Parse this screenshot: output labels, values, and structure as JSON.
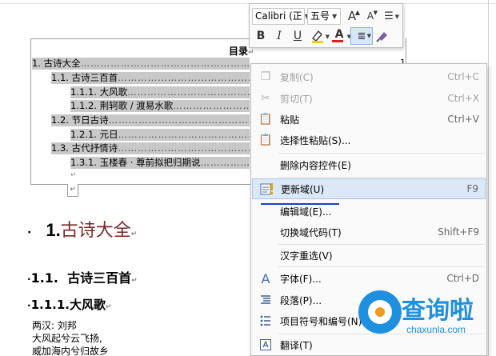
{
  "toolbar": {
    "font_name": "Calibri (正",
    "font_size": "五号",
    "grow_font": "A",
    "shrink_font": "A",
    "bold": "B",
    "italic": "I",
    "underline": "U",
    "font_color": "A"
  },
  "toc": {
    "title": "目录",
    "entries": [
      {
        "text": "1. 古诗大全",
        "page": "1"
      },
      {
        "text": "1.1. 古诗三百首"
      },
      {
        "text": "1.1.1. 大风歌"
      },
      {
        "text": "1.1.2. 荆轲歌 / 渡易水歌"
      },
      {
        "text": "1.2. 节日古诗"
      },
      {
        "text": "1.2.1. 元日"
      },
      {
        "text": "1.3. 古代抒情诗"
      },
      {
        "text": "1.3.1. 玉楼春 · 尊前拟把归期说"
      }
    ]
  },
  "body": {
    "h1_num": "1.",
    "h1_text": "古诗大全",
    "h2_num": "1.1.",
    "h2_text": "古诗三百首",
    "h3_num": "1.1.1.",
    "h3_text": "大风歌",
    "lines": [
      "两汉: 刘邦",
      "大风起兮云飞扬,",
      "威加海内兮归故乡"
    ]
  },
  "context_menu": {
    "items": [
      {
        "label": "复制(C)",
        "shortcut": "Ctrl+C",
        "icon": "copy-icon",
        "disabled": true
      },
      {
        "label": "剪切(T)",
        "shortcut": "Ctrl+X",
        "icon": "scissors-icon",
        "disabled": true
      },
      {
        "label": "粘贴",
        "shortcut": "Ctrl+V",
        "icon": "paste-icon"
      },
      {
        "label": "选择性粘贴(S)...",
        "icon": "paste-special-icon"
      },
      {
        "label": "删除内容控件(E)"
      },
      {
        "label": "更新域(U)",
        "shortcut": "F9",
        "icon": "update-field-icon",
        "highlighted": true
      },
      {
        "label": "编辑域(E)..."
      },
      {
        "label": "切换域代码(T)",
        "shortcut": "Shift+F9"
      },
      {
        "label": "汉字重选(V)"
      },
      {
        "label": "字体(F)...",
        "shortcut": "Ctrl+D",
        "icon": "font-icon"
      },
      {
        "label": "段落(P)...",
        "icon": "paragraph-icon"
      },
      {
        "label": "项目符号和编号(N)...",
        "icon": "bullets-icon"
      },
      {
        "label": "翻译(T)",
        "icon": "translate-icon"
      }
    ]
  },
  "watermark": {
    "text": "查询啦",
    "sub": "chaxunla.com"
  },
  "colors": {
    "menu_highlight": "#dbe8f7",
    "accent_blue": "#1f8fe0",
    "accent_orange": "#f29a1c",
    "underline": "#1a3fd1"
  }
}
